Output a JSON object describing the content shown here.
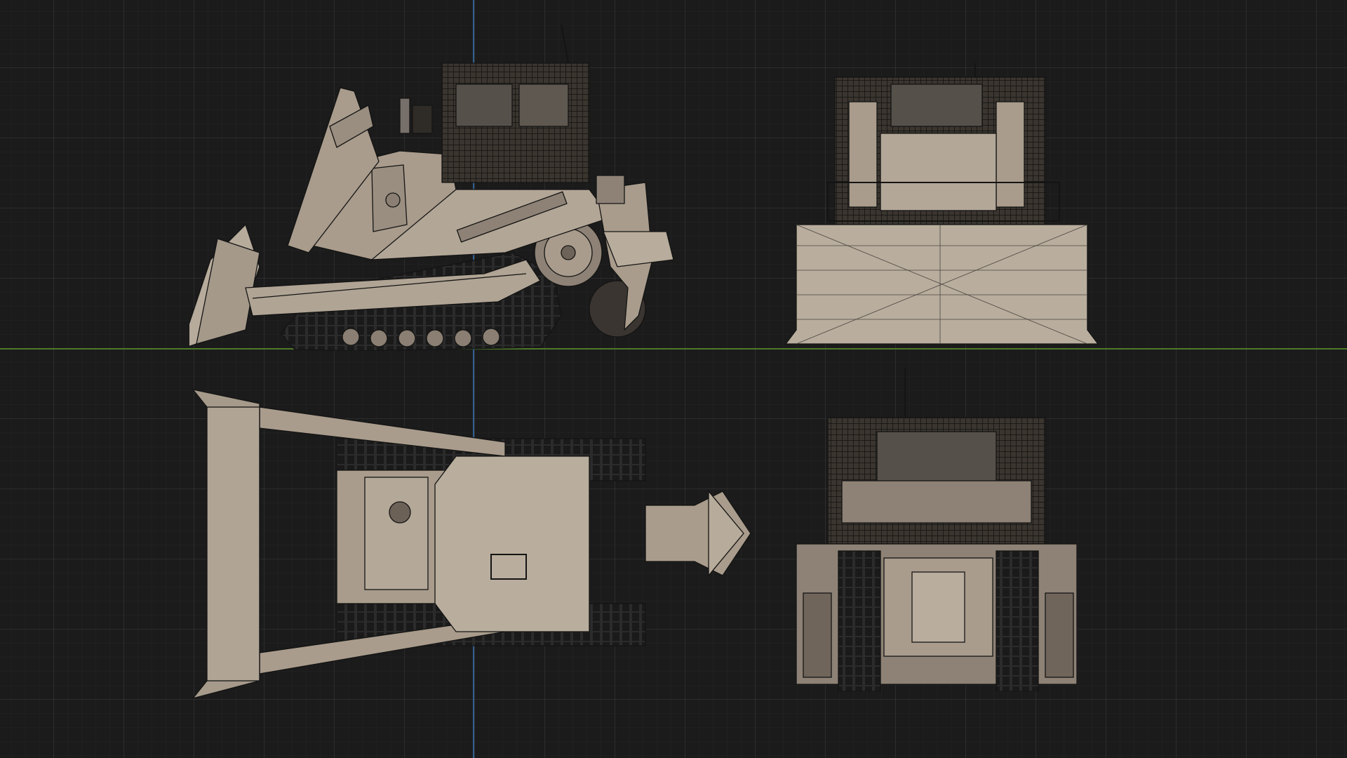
{
  "viewport": {
    "background_color": "#1b1b1b",
    "grid_color": "#2a2a2a",
    "axis_x_color": "#4e7a2a",
    "axis_y_color": "#2f5f8f"
  },
  "model": {
    "body_color": "#a99c8c",
    "body_shade_color": "#7d7163",
    "wire_color": "#141414",
    "track_color": "#2b2b2b",
    "views": [
      "side",
      "front",
      "top",
      "back"
    ]
  }
}
